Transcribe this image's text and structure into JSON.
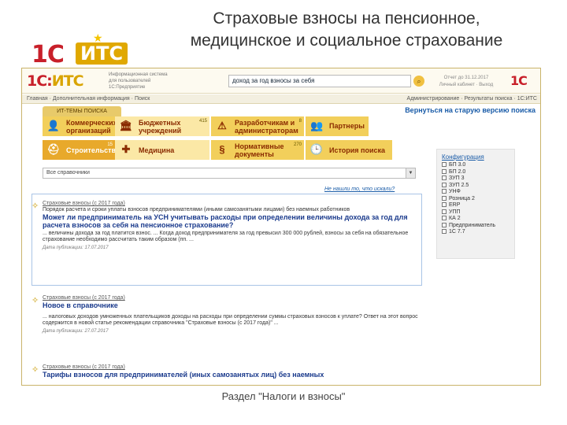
{
  "slide": {
    "title_line1": "Страховые взносы на пенсионное,",
    "title_line2": "медицинское и социальное страхование",
    "caption": "Раздел \"Налоги и взносы\"",
    "logo": {
      "mark": "1С",
      "its": "ИТС",
      "star": "★"
    }
  },
  "header": {
    "logo_main": "1С:",
    "logo_accent": "ИТС",
    "info_line1": "Информационная система",
    "info_line2": "для пользователей",
    "info_line3": "1С:Предприятие",
    "search_value": "доход за год взносы за себя",
    "search_icon": "magnifier-icon",
    "search_btn": "⌕",
    "right_info1": "Отчет до 31.12.2017",
    "right_info2": "Личный кабинет · Выход",
    "logo2": "1С"
  },
  "nav": {
    "left": "Главная · Дополнительная информация · Поиск",
    "right": "Администрирование · Результаты поиска · 1С:ИТС"
  },
  "tabs": {
    "active": "ИТ-ТЕМЫ ПОИСКА",
    "old_version": "Вернуться на старую версию поиска"
  },
  "categories": [
    {
      "label1": "Коммерческих",
      "label2": "организаций",
      "icon": "👤"
    },
    {
      "label1": "Бюджетных",
      "label2": "учреждений",
      "icon": "🏛",
      "count": "415"
    },
    {
      "label1": "Разработчикам и",
      "label2": "администраторам",
      "icon": "⚠",
      "count": "8"
    },
    {
      "label1": "Строительство",
      "label2": "",
      "icon": "⛑",
      "count": "15"
    },
    {
      "label1": "Медицина",
      "label2": "",
      "icon": "✚"
    },
    {
      "label1": "Нормативные",
      "label2": "документы",
      "icon": "§",
      "count": "270"
    },
    {
      "label1": "История поиска",
      "label2": "",
      "icon": "🕒"
    }
  ],
  "partner": {
    "label": "Партнеры",
    "icon": "👥"
  },
  "combo": {
    "value": "Все справочники"
  },
  "not_found_link": "Не нашли то, что искали?",
  "config": {
    "header": "Конфигурация",
    "items": [
      "БП 3.0",
      "БП 2.0",
      "ЗУП 3",
      "ЗУП 2.5",
      "УНФ",
      "Розница 2",
      "ERP",
      "УПП",
      "КА 2",
      "Предприниматель",
      "1С 7.7"
    ]
  },
  "results": [
    {
      "source": "Страховые взносы (с 2017 года)",
      "subtitle": "Порядок расчета и сроки уплаты взносов предпринимателями (иными самозанятыми лицами) без наемных работников",
      "title": "Может ли предприниматель на УСН учитывать расходы при определении величины дохода за год для расчета взносов за себя на пенсионное страхование?",
      "snippet": "... величины дохода за год платится взнос. ... Когда доход предпринимателя за год превысил 300 000 рублей, взносы за себя на обязательное страхование необходимо рассчитать таким образом (пп. ...",
      "date": "Дата публикации: 17.07.2017"
    },
    {
      "source": "Страховые взносы (с 2017 года)",
      "subtitle": "",
      "title": "Новое в справочнике",
      "snippet": "... налоговых доходов умноженных плательщиков доходы на расходы при определении суммы страховых взносов к уплате? Ответ на этот вопрос содержится в новой статье рекомендации справочника \"Страховые взносы (с 2017 года)\" ...",
      "date": "Дата публикации: 27.07.2017"
    },
    {
      "source": "Страховые взносы (с 2017 года)",
      "subtitle": "",
      "title": "Тарифы взносов для предпринимателей (иных самозанятых лиц) без наемных",
      "snippet": "",
      "date": ""
    }
  ]
}
